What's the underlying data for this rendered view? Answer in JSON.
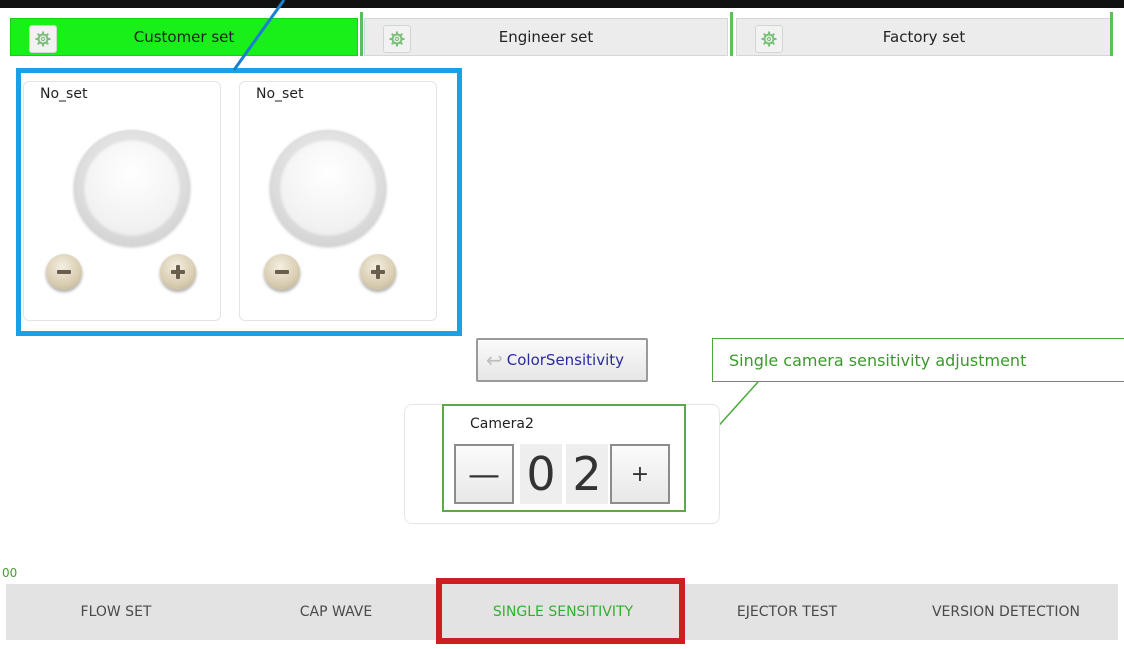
{
  "top_tabs": [
    {
      "label": "Customer set",
      "active": true,
      "icon": "gear-icon"
    },
    {
      "label": "Engineer set",
      "active": false,
      "icon": "gear-icon"
    },
    {
      "label": "Factory set",
      "active": false,
      "icon": "gear-icon"
    }
  ],
  "channel_panels": [
    {
      "label": "No_set",
      "minus_icon": "minus-icon",
      "plus_icon": "plus-icon"
    },
    {
      "label": "No_set",
      "minus_icon": "minus-icon",
      "plus_icon": "plus-icon"
    }
  ],
  "color_sensitivity_button": {
    "label": "ColorSensitivity",
    "icon": "return-arrow-icon"
  },
  "callout": {
    "text": "Single camera sensitivity adjustment"
  },
  "camera": {
    "label": "Camera2",
    "value_digits": [
      "0",
      "2"
    ],
    "minus_label": "—",
    "plus_label": "+"
  },
  "counter_text": "00",
  "bottom_nav": [
    {
      "label": "FLOW SET",
      "active": false
    },
    {
      "label": "CAP WAVE",
      "active": false
    },
    {
      "label": "SINGLE SENSITIVITY",
      "active": true
    },
    {
      "label": "EJECTOR TEST",
      "active": false
    },
    {
      "label": "VERSION DETECTION",
      "active": false
    }
  ],
  "colors": {
    "active_tab": "#19f019",
    "panel_frame": "#1aa0e6",
    "callout_green": "#4aaa3a",
    "nav_highlight": "#cc1f1f",
    "active_nav_text": "#30b030"
  }
}
